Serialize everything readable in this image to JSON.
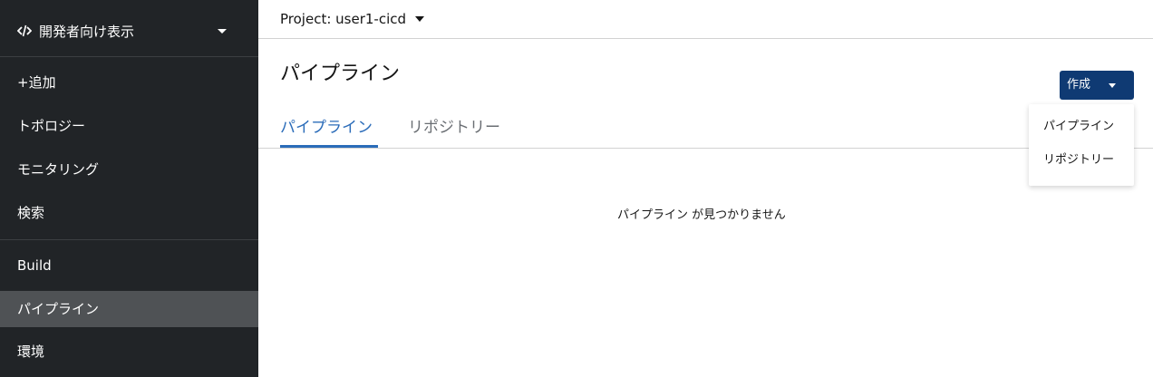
{
  "sidebar": {
    "perspective": {
      "label": "開発者向け表示",
      "icon": "code-icon"
    },
    "items": [
      {
        "label": "+追加"
      },
      {
        "label": "トポロジー"
      },
      {
        "label": "モニタリング"
      },
      {
        "label": "検索"
      },
      {
        "label": "Build"
      },
      {
        "label": "パイプライン",
        "active": true
      },
      {
        "label": "環境"
      }
    ]
  },
  "project_bar": {
    "label": "Project: user1-cicd"
  },
  "main": {
    "title": "パイプライン",
    "create_button": {
      "label": "作成"
    },
    "create_menu": [
      {
        "label": "パイプライン"
      },
      {
        "label": "リポジトリー"
      }
    ],
    "tabs": [
      {
        "label": "パイプライン",
        "active": true
      },
      {
        "label": "リポジトリー",
        "active": false
      }
    ],
    "empty_message": "パイプライン が見つかりません"
  },
  "colors": {
    "sidebar_bg": "#212427",
    "sidebar_active": "#4f5255",
    "primary_button": "#0f3a73",
    "tab_active": "#2b6cb9"
  }
}
